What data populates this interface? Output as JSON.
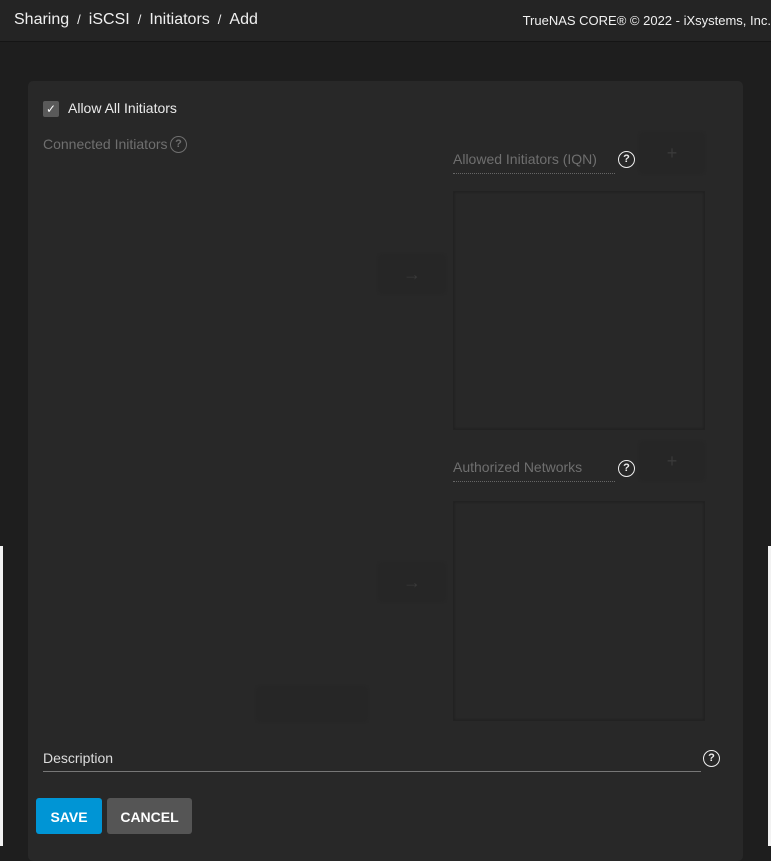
{
  "header": {
    "breadcrumbs": [
      "Sharing",
      "iSCSI",
      "Initiators",
      "Add"
    ],
    "separator": "/",
    "copyright": "TrueNAS CORE® © 2022 - iXsystems, Inc."
  },
  "form": {
    "allow_all": {
      "label": "Allow All Initiators",
      "checked": true
    },
    "connected_initiators": {
      "label": "Connected Initiators"
    },
    "allowed_initiators": {
      "label": "Allowed Initiators (IQN)",
      "value": ""
    },
    "authorized_networks": {
      "label": "Authorized Networks",
      "value": ""
    },
    "description": {
      "label": "Description",
      "value": ""
    },
    "icons": {
      "help": "?",
      "add": "+",
      "arrow": "→",
      "check": "✓"
    },
    "save_label": "SAVE",
    "cancel_label": "CANCEL"
  },
  "colors": {
    "primary": "#0095d5",
    "card": "#282828",
    "background": "#1e1e1e"
  }
}
